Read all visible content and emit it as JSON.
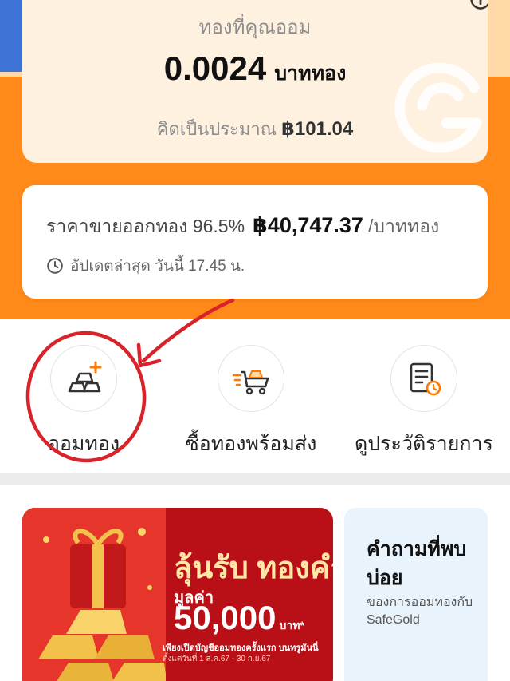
{
  "savings": {
    "title": "ทองที่คุณออม",
    "amount": "0.0024",
    "unit": "บาททอง",
    "equivalent_label": "คิดเป็นประมาณ",
    "equivalent_value": "฿101.04"
  },
  "price": {
    "label": "ราคาขายออกทอง 96.5%",
    "value": "฿40,747.37",
    "unit": "/บาททอง",
    "updated": "อัปเดตล่าสุด วันนี้ 17.45 น."
  },
  "actions": [
    {
      "label": "ออมทอง",
      "icon": "gold-bar-add-icon"
    },
    {
      "label": "ซื้อทองพร้อมส่ง",
      "icon": "delivery-cart-icon"
    },
    {
      "label": "ดูประวัติรายการ",
      "icon": "history-document-icon"
    }
  ],
  "promo": {
    "headline": "ลุ้นรับ ทองคำ!",
    "value_label": "มูลค่า",
    "amount": "50,000",
    "currency": "บาท*",
    "condition": "เพียงเปิดบัญชีออมทองครั้งแรก บนทรูมันนี่",
    "period": "ตั้งแต่วันที่ 1 ส.ค.67 - 30 ก.ย.67"
  },
  "faq": {
    "title": "คำถามที่พบบ่อย",
    "subtitle": "ของการออมทองกับ SafeGold"
  },
  "colors": {
    "accent_orange": "#ff8a1a",
    "annotation_red": "#d8232a",
    "promo_red": "#b81016"
  }
}
